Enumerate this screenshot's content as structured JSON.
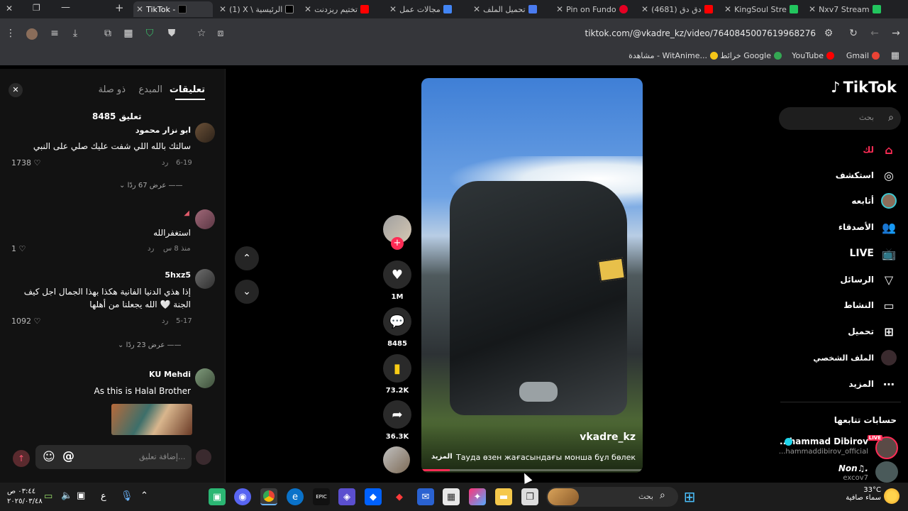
{
  "tabs": [
    {
      "label": "TikTok - ",
      "active": true,
      "color": "#000000"
    },
    {
      "label": "(1) X \\ الرئيسية",
      "color": "#000000"
    },
    {
      "label": "تختيم ريزدنت",
      "color": "#ff0000"
    },
    {
      "label": "مجالات عمل",
      "color": "#4285f4"
    },
    {
      "label": "تحميل الملف",
      "color": "#4a7bf0"
    },
    {
      "label": "Pin on Fundo",
      "color": "#e60023"
    },
    {
      "label": "(4681) دق دق",
      "color": "#ff0000"
    },
    {
      "label": "KingSoul Stre",
      "color": "#22c55e"
    },
    {
      "label": "Nxv7 Stream",
      "color": "#22c55e"
    }
  ],
  "address": {
    "url": "tiktok.com/@vkadre_kz/video/7640845007619968276"
  },
  "bookmarks": [
    {
      "label": "Gmail",
      "color": "#ea4335"
    },
    {
      "label": "YouTube",
      "color": "#ff0000"
    },
    {
      "label": "خرائط Google",
      "color": "#34a853"
    },
    {
      "label": "مشاهدة - WitAnime...",
      "color": "#f5c518"
    }
  ],
  "comments_panel": {
    "tabs": [
      "تعليقات",
      "المبدع",
      "ذو صلة"
    ],
    "count_label": "8485 تعليق",
    "comments": [
      {
        "user": "ابو نزار محمود",
        "text": "سالتك بالله اللي شفت عليك صلي على النبي",
        "date": "6-19",
        "reply": "رد",
        "likes": "1738",
        "view_replies": "عرض 67 ردًا"
      },
      {
        "user": "",
        "text": "استغفرالله",
        "date": "منذ 8 س",
        "reply": "رد",
        "likes": "1"
      },
      {
        "user": "5hxz5",
        "text": "إذا هذي الدنيا الفانية هكذا بهذا الجمال اجل كيف الجنة 🤍 الله يجعلنا من أهلها",
        "date": "5-17",
        "reply": "رد",
        "likes": "1092",
        "view_replies": "عرض 23 ردًا"
      },
      {
        "user": "KU Mehdi",
        "text": "As this is Halal Brother"
      }
    ],
    "input_placeholder": "إضافة تعليق..."
  },
  "video": {
    "username": "vkadre_kz",
    "caption": "Тауда өзен жағасындағы монша бұл бөлек",
    "more_label": "المزيد"
  },
  "actions": {
    "likes": "1M",
    "comments": "8485",
    "saves": "73.2K",
    "shares": "36.3K"
  },
  "nav": {
    "logo": "TikTok",
    "search_placeholder": "بحث",
    "items": [
      "لك",
      "استكشف",
      "أتابعه",
      "الأصدقاء",
      "LIVE",
      "الرسائل",
      "النشاط",
      "تحميل",
      "الملف الشخصي",
      "المزيد"
    ],
    "following_title": "حسابات تتابعها",
    "following": [
      {
        "name": "hammad Dibirov...",
        "handle": "hammaddibirov_official..."
      },
      {
        "name": "Non♫.",
        "handle": "excov7"
      }
    ]
  },
  "taskbar": {
    "search_placeholder": "بحث",
    "weather_temp": "33°C",
    "weather_desc": "سماء صافية",
    "time": "٠٣:٤٤ ص",
    "date": "٢٠٢٥/٠٣/٤٨",
    "lang": "ع"
  }
}
